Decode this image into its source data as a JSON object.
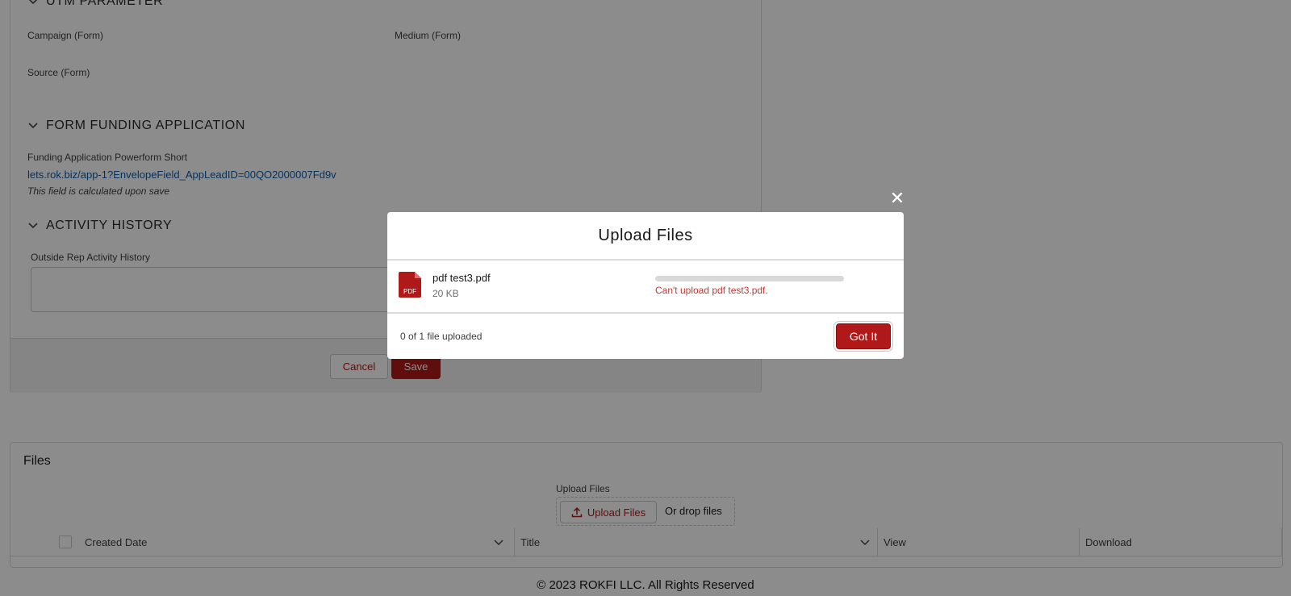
{
  "record": {
    "sections": {
      "utm": {
        "title": "UTM PARAMETER",
        "campaign_label": "Campaign (Form)",
        "medium_label": "Medium (Form)",
        "source_label": "Source (Form)"
      },
      "funding": {
        "title": "FORM FUNDING APPLICATION",
        "field_label": "Funding Application Powerform Short",
        "field_value": "lets.rok.biz/app-1?EnvelopeField_AppLeadID=00QO2000007Fd9v",
        "field_note": "This field is calculated upon save"
      },
      "activity": {
        "title": "ACTIVITY HISTORY",
        "field_label": "Outside Rep Activity History"
      }
    },
    "footer": {
      "cancel_label": "Cancel",
      "save_label": "Save"
    }
  },
  "files": {
    "title": "Files",
    "upload_label": "Upload Files",
    "upload_button": "Upload Files",
    "drop_text": "Or drop files",
    "columns": {
      "created_date": "Created Date",
      "title": "Title",
      "view": "View",
      "download": "Download"
    }
  },
  "copyright": "© 2023 ROKFI LLC. All Rights Reserved",
  "modal": {
    "close_icon": "close-icon",
    "title": "Upload Files",
    "file": {
      "name": "pdf test3.pdf",
      "size": "20 KB",
      "type_badge": "PDF",
      "progress": 0,
      "error": "Can't upload pdf test3.pdf."
    },
    "status": "0 of 1 file uploaded",
    "confirm_label": "Got It"
  },
  "colors": {
    "brand": "#b0191a",
    "link": "#0b5cab",
    "error": "#c23934"
  }
}
